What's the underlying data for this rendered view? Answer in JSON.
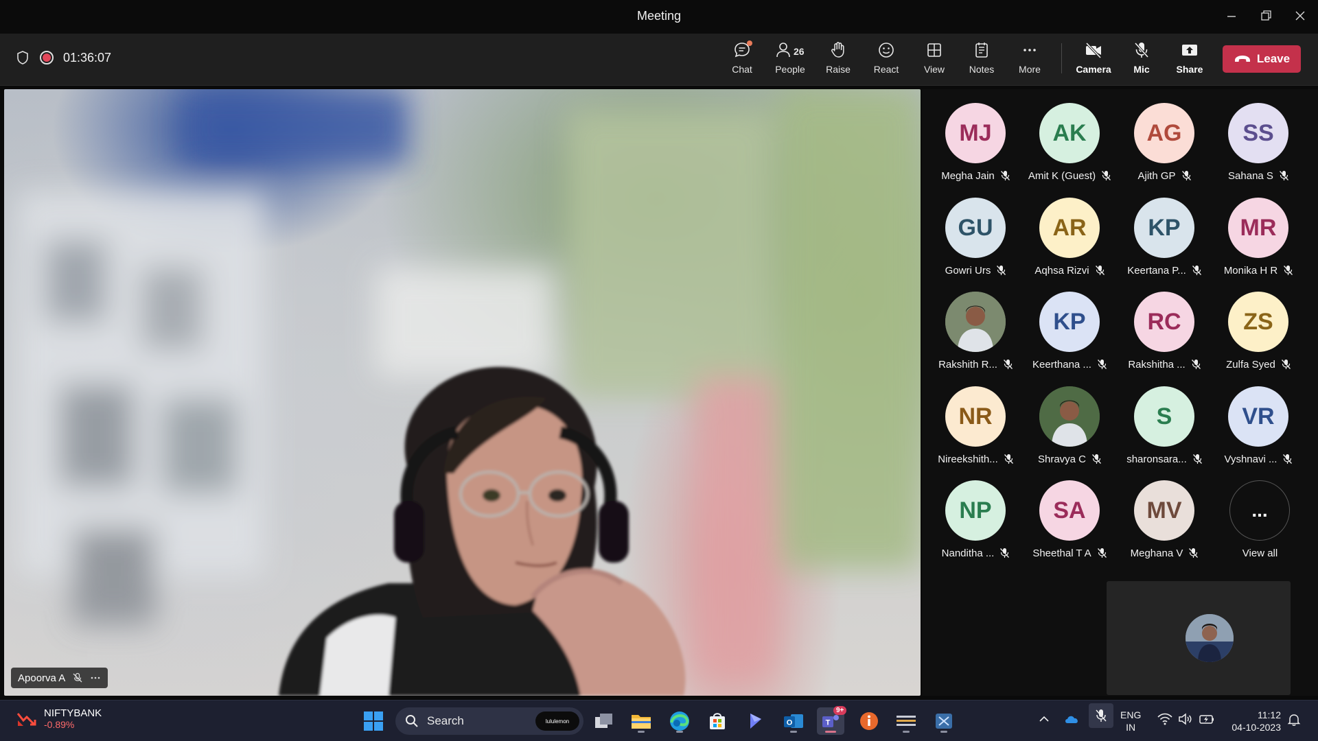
{
  "window": {
    "title": "Meeting"
  },
  "toolbar": {
    "timer": "01:36:07",
    "chat_label": "Chat",
    "people_label": "People",
    "people_count": "26",
    "raise_label": "Raise",
    "react_label": "React",
    "view_label": "View",
    "notes_label": "Notes",
    "more_label": "More",
    "camera_label": "Camera",
    "mic_label": "Mic",
    "share_label": "Share",
    "leave_label": "Leave"
  },
  "main_video": {
    "speaker_name": "Apoorva A"
  },
  "participants": [
    {
      "initials": "MJ",
      "name": "Megha Jain",
      "bg": "#f6d6e3",
      "fg": "#9b2c5a"
    },
    {
      "initials": "AK",
      "name": "Amit K (Guest)",
      "bg": "#d6f0e0",
      "fg": "#2a7d4f"
    },
    {
      "initials": "AG",
      "name": "Ajith GP",
      "bg": "#fbddd6",
      "fg": "#b04a3c"
    },
    {
      "initials": "SS",
      "name": "Sahana S",
      "bg": "#e3dff2",
      "fg": "#5b4e8e"
    },
    {
      "initials": "GU",
      "name": "Gowri Urs",
      "bg": "#d9e4ec",
      "fg": "#2e5368"
    },
    {
      "initials": "AR",
      "name": "Aqhsa Rizvi",
      "bg": "#fdf0c8",
      "fg": "#8a6418"
    },
    {
      "initials": "KP",
      "name": "Keertana P...",
      "bg": "#d9e4ec",
      "fg": "#2e5368"
    },
    {
      "initials": "MR",
      "name": "Monika H R",
      "bg": "#f6d6e3",
      "fg": "#9b2c5a"
    },
    {
      "initials": "",
      "name": "Rakshith R...",
      "bg": "#7c8a6f",
      "fg": "#ffffff"
    },
    {
      "initials": "KP",
      "name": "Keerthana ...",
      "bg": "#dbe3f5",
      "fg": "#2f4f8c"
    },
    {
      "initials": "RC",
      "name": "Rakshitha ...",
      "bg": "#f6d6e3",
      "fg": "#9b2c5a"
    },
    {
      "initials": "ZS",
      "name": "Zulfa Syed",
      "bg": "#fdf0c8",
      "fg": "#8a6418"
    },
    {
      "initials": "NR",
      "name": "Nireekshith...",
      "bg": "#fcead0",
      "fg": "#8a5a18"
    },
    {
      "initials": "",
      "name": "Shravya C",
      "bg": "#4f6b45",
      "fg": "#ffffff"
    },
    {
      "initials": "S",
      "name": "sharonsara...",
      "bg": "#d6f0e0",
      "fg": "#2a7d4f"
    },
    {
      "initials": "VR",
      "name": "Vyshnavi ...",
      "bg": "#dbe3f5",
      "fg": "#2f4f8c"
    },
    {
      "initials": "NP",
      "name": "Nanditha ...",
      "bg": "#d6f0e0",
      "fg": "#2a7d4f"
    },
    {
      "initials": "SA",
      "name": "Sheethal T A",
      "bg": "#f6d6e3",
      "fg": "#9b2c5a"
    },
    {
      "initials": "MV",
      "name": "Meghana V",
      "bg": "#e9dfda",
      "fg": "#6e4a3c"
    }
  ],
  "view_all": {
    "label": "View all",
    "icon": "..."
  },
  "taskbar": {
    "ticker_name": "NIFTYBANK",
    "ticker_change": "-0.89%",
    "search_label": "Search",
    "search_pill": "lululemon",
    "teams_badge": "9+",
    "lang_line1": "ENG",
    "lang_line2": "IN",
    "time": "11:12",
    "date": "04-10-2023"
  },
  "colors": {
    "leave": "#c4314b",
    "recording": "#e2475a",
    "ticker_negative": "#ff6b6b"
  }
}
